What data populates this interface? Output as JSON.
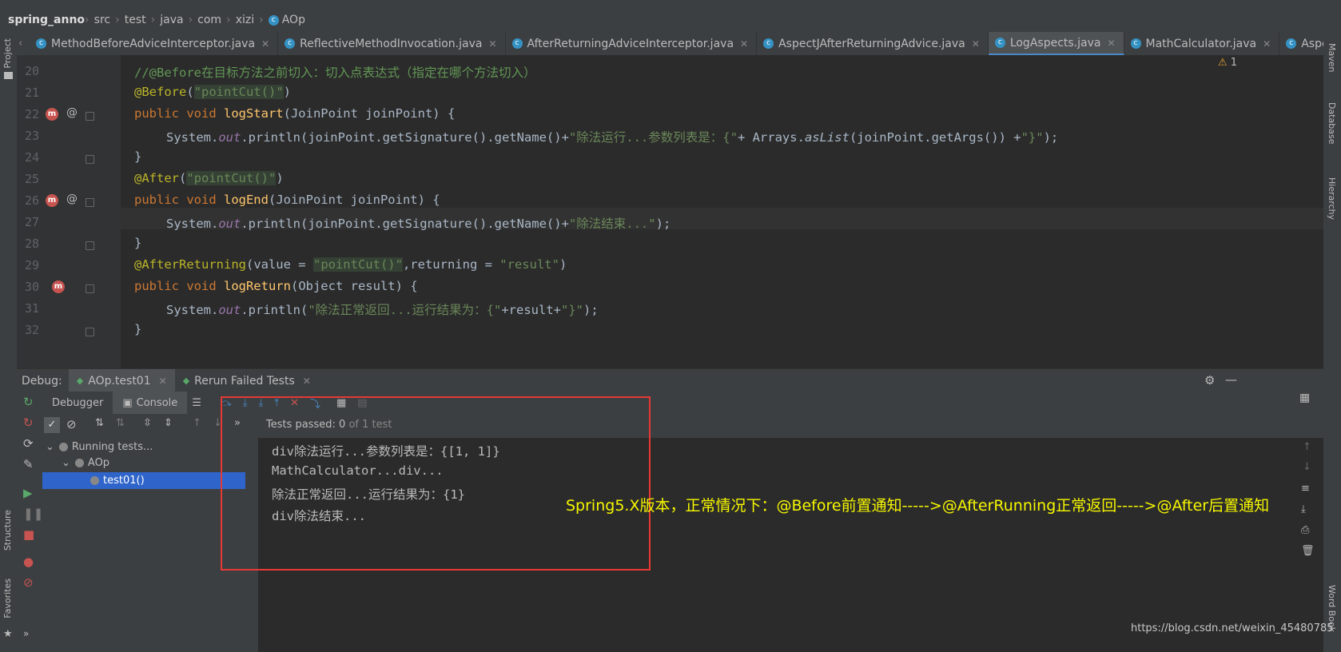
{
  "breadcrumb": {
    "project": "spring_anno",
    "path": [
      "src",
      "test",
      "java",
      "com",
      "xizi"
    ],
    "current": "AOp",
    "run_config": "AOp.test01"
  },
  "tabs": [
    {
      "label": "MethodBeforeAdviceInterceptor.java",
      "active": false
    },
    {
      "label": "ReflectiveMethodInvocation.java",
      "active": false
    },
    {
      "label": "AfterReturningAdviceInterceptor.java",
      "active": false
    },
    {
      "label": "AspectJAfterReturningAdvice.java",
      "active": false
    },
    {
      "label": "LogAspects.java",
      "active": true
    },
    {
      "label": "MathCalculator.java",
      "active": false
    },
    {
      "label": "AspectJAfterA",
      "active": false
    }
  ],
  "editor": {
    "warning_count": "1",
    "line_numbers": [
      "20",
      "21",
      "22",
      "23",
      "24",
      "25",
      "26",
      "27",
      "28",
      "29",
      "30",
      "31",
      "32"
    ],
    "l20_comment": "//@Before在目标方法之前切入：切入点表达式（指定在哪个方法切入）",
    "l21_ann": "@Before",
    "l21_str": "\"pointCut()\"",
    "l22_kw": "public void ",
    "l22_fn": "logStart",
    "l22_rest": "(JoinPoint joinPoint) {",
    "l23_a": "System.",
    "l23_out": "out",
    "l23_b": ".println(joinPoint.getSignature().getName()+",
    "l23_str1": "\"除法运行...参数列表是：{\"",
    "l23_c": "+ Arrays.",
    "l23_aslist": "asList",
    "l23_d": "(joinPoint.getArgs()) +",
    "l23_str2": "\"}\"",
    "l23_e": ");",
    "l24": "}",
    "l25_ann": "@After",
    "l25_str": "\"pointCut()\"",
    "l26_kw": "public void ",
    "l26_fn": "logEnd",
    "l26_rest": "(JoinPoint joinPoint) {",
    "l27_a": "System.",
    "l27_out": "out",
    "l27_b": ".println(joinPoint.getSignature().getName()+",
    "l27_str": "\"除法结束...\"",
    "l27_e": ");",
    "l28": "}",
    "l29_ann": "@AfterReturning",
    "l29_a": "(value = ",
    "l29_str1": "\"pointCut()\"",
    "l29_b": ",returning = ",
    "l29_str2": "\"result\"",
    "l29_c": ")",
    "l30_kw": "public void ",
    "l30_fn": "logReturn",
    "l30_rest": "(Object result) {",
    "l31_a": "System.",
    "l31_out": "out",
    "l31_b": ".println(",
    "l31_str1": "\"除法正常返回...运行结果为：{\"",
    "l31_c": "+result+",
    "l31_str2": "\"}\"",
    "l31_e": ");",
    "l32": "}"
  },
  "debug": {
    "label": "Debug:",
    "tabs": [
      {
        "label": "AOp.test01",
        "active": true
      },
      {
        "label": "Rerun Failed Tests",
        "active": false
      }
    ],
    "subtabs": [
      "Debugger",
      "Console"
    ],
    "tests_passed_label": "Tests passed:",
    "tests_passed_value": "0",
    "tests_passed_suffix": "of 1 test",
    "tree": [
      {
        "label": "Running tests...",
        "depth": 0,
        "selected": false
      },
      {
        "label": "AOp",
        "depth": 1,
        "selected": false
      },
      {
        "label": "test01()",
        "depth": 2,
        "selected": true
      }
    ],
    "console_lines": [
      "div除法运行...参数列表是：{[1, 1]}",
      "MathCalculator...div...",
      "除法正常返回...运行结果为：{1}",
      "div除法结束..."
    ]
  },
  "side_labels": {
    "project": "Project",
    "structure": "Structure",
    "favorites": "Favorites",
    "maven": "Maven",
    "database": "Database",
    "hierarchy": "Hierarchy",
    "word_book": "Word Book"
  },
  "annotation_note": "Spring5.X版本，正常情况下：@Before前置通知----->@AfterRunning正常返回----->@After后置通知",
  "watermark": "https://blog.csdn.net/weixin_45480785",
  "colors": {
    "red_box": "#e53935",
    "note": "#f7f700",
    "accent": "#4a88c7"
  }
}
